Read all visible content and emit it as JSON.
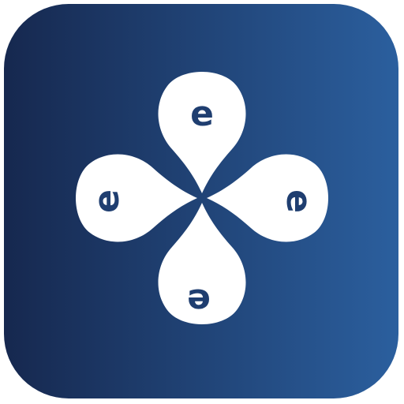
{
  "icon": {
    "name": "app-icon",
    "background_gradient": [
      "#16284f",
      "#2b5f9e"
    ],
    "petal_color": "#ffffff",
    "letter_color": "#1f3e70",
    "petals": [
      {
        "position": "top",
        "letter": "e"
      },
      {
        "position": "right",
        "letter": "e"
      },
      {
        "position": "bottom",
        "letter": "e"
      },
      {
        "position": "left",
        "letter": "e"
      }
    ]
  }
}
